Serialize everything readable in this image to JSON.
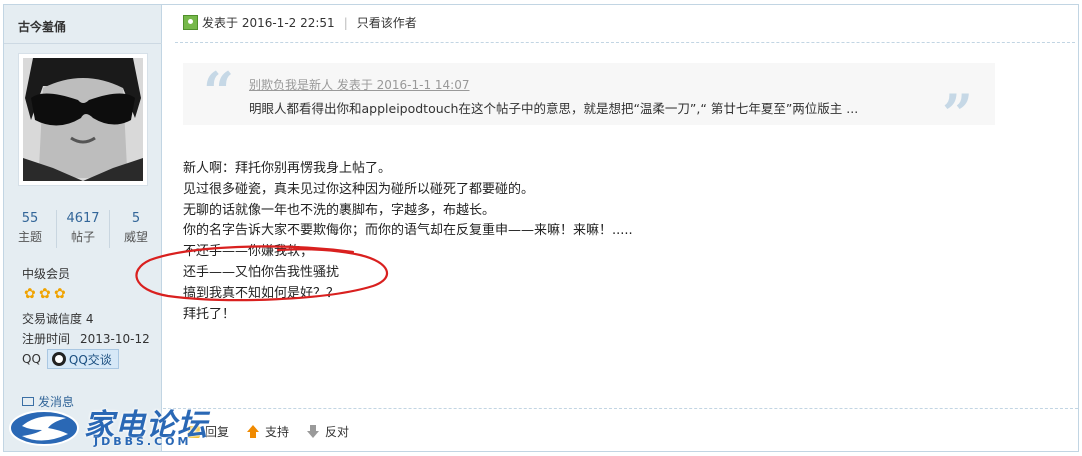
{
  "author": {
    "name": "古今羞俑"
  },
  "stats": [
    {
      "value": "55",
      "label": "主题"
    },
    {
      "value": "4617",
      "label": "帖子"
    },
    {
      "value": "5",
      "label": "威望"
    }
  ],
  "profile": {
    "rank": "中级会员",
    "stars": 3,
    "credit": "交易诚信度 4",
    "reg_label": "注册时间",
    "reg_date": "2013-10-12",
    "qq_label": "QQ",
    "qq_button": "QQ交谈",
    "message_link": "发消息"
  },
  "post": {
    "posted_at": "发表于 2016-1-2 22:51",
    "only_author": "只看该作者"
  },
  "quote": {
    "meta": "别欺负我是新人 发表于 2016-1-1 14:07",
    "text": "明眼人都看得出你和appleipodtouch在这个帖子中的意思，就是想把“温柔一刀”,“ 第廿七年夏至”两位版主 ..."
  },
  "content": {
    "lines": [
      "新人啊：拜托你别再愣我身上帖了。",
      "见过很多碰瓷，真未见过你这种因为碰所以碰死了都要碰的。",
      "无聊的话就像一年也不洗的裹脚布，字越多，布越长。",
      "你的名字告诉大家不要欺侮你；而你的语气却在反复重申——来嘛！来嘛！.....",
      "不还手——你嫌我软；",
      "还手——又怕你告我性骚扰",
      "搞到我真不知如何是好？？",
      "拜托了！"
    ]
  },
  "actions": {
    "reply": "回复",
    "support": "支持",
    "oppose": "反对"
  },
  "watermark": {
    "cn": "家电论坛",
    "en": "JDBBS.COM"
  },
  "colors": {
    "sidebar_bg": "#e5edf2",
    "border": "#c2d5e3",
    "link": "#336699",
    "annotation_red": "#d9201f",
    "logo_blue": "#2a68b5"
  }
}
